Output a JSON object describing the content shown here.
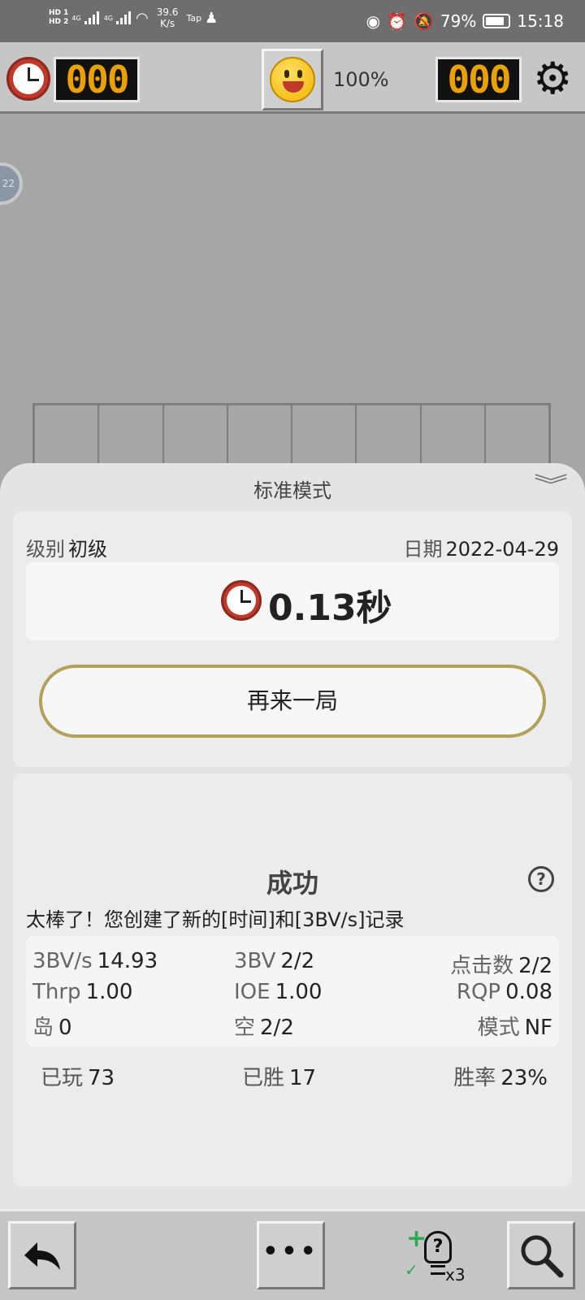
{
  "status_bar": {
    "hd1": "HD 1",
    "hd2": "HD 2",
    "net1": "4G",
    "net2": "4G",
    "speed_value": "39.6",
    "speed_unit": "K/s",
    "tap": "Tap",
    "battery": "79%",
    "time": "15:18"
  },
  "header": {
    "mine_counter": "000",
    "zoom": "100%",
    "time_counter": "000",
    "icons": [
      "clock-icon",
      "smiley-face-icon",
      "gear-icon"
    ]
  },
  "side_badge": "22",
  "result_sheet": {
    "title": "标准模式",
    "level_label": "级别",
    "level_value": "初级",
    "date_label": "日期",
    "date_value": "2022-04-29",
    "time_value": "0.13秒",
    "play_again": "再来一局",
    "result_title": "成功",
    "message": "太棒了！您创建了新的[时间]和[3BV/s]记录",
    "stats": [
      {
        "label": "3BV/s",
        "value": "14.93"
      },
      {
        "label": "3BV",
        "value": "2/2"
      },
      {
        "label": "点击数",
        "value": "2/2"
      },
      {
        "label": "Thrp",
        "value": "1.00"
      },
      {
        "label": "IOE",
        "value": "1.00"
      },
      {
        "label": "RQP",
        "value": "0.08"
      },
      {
        "label": "岛",
        "value": "0"
      },
      {
        "label": "空",
        "value": "2/2"
      },
      {
        "label": "模式",
        "value": "NF"
      }
    ],
    "totals": [
      {
        "label": "已玩",
        "value": "73"
      },
      {
        "label": "已胜",
        "value": "17"
      },
      {
        "label": "胜率",
        "value": "23%"
      }
    ]
  },
  "toolbar": {
    "hint_count": "x3",
    "icons": [
      "undo-icon",
      "more-icon",
      "hint-icon",
      "search-icon"
    ]
  },
  "colors": {
    "counter_digits": "#e8a100",
    "button_border": "#b3a05a",
    "accent_green": "#2fa84f"
  }
}
